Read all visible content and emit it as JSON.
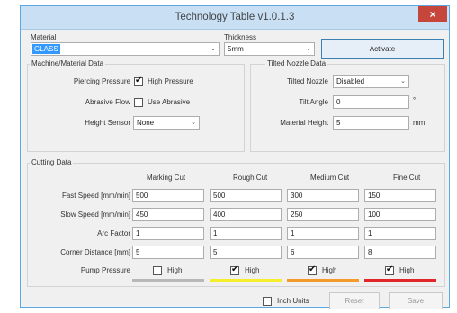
{
  "window": {
    "title": "Technology Table v1.0.1.3",
    "close_glyph": "×"
  },
  "material": {
    "label": "Material",
    "value": "GLASS"
  },
  "thickness": {
    "label": "Thickness",
    "value": "5mm"
  },
  "activate_label": "Activate",
  "machine": {
    "caption": "Machine/Material Data",
    "piercing_label": "Piercing Pressure",
    "high_pressure_label": "High Pressure",
    "high_pressure_checked": true,
    "abrasive_label": "Abrasive Flow",
    "use_abrasive_label": "Use Abrasive",
    "use_abrasive_checked": false,
    "height_label": "Height Sensor",
    "height_value": "None"
  },
  "tilted": {
    "caption": "Tilted Nozzle Data",
    "nozzle_label": "Tilted Nozzle",
    "nozzle_value": "Disabled",
    "angle_label": "Tilt Angle",
    "angle_value": "0",
    "angle_unit": "°",
    "height_label": "Material Height",
    "height_value": "5",
    "height_unit": "mm"
  },
  "cutting": {
    "caption": "Cutting Data",
    "columns": [
      "Marking Cut",
      "Rough Cut",
      "Medium Cut",
      "Fine Cut"
    ],
    "rows": [
      {
        "label": "Fast Speed  [mm/min]",
        "values": [
          "500",
          "500",
          "300",
          "150"
        ]
      },
      {
        "label": "Slow Speed  [mm/min]",
        "values": [
          "450",
          "400",
          "250",
          "100"
        ]
      },
      {
        "label": "Arc Factor",
        "values": [
          "1",
          "1",
          "1",
          "1"
        ]
      },
      {
        "label": "Corner Distance  [mm]",
        "values": [
          "5",
          "5",
          "6",
          "8"
        ]
      }
    ],
    "pump_label": "Pump Pressure",
    "pump": [
      {
        "label": "High",
        "checked": false,
        "color": "#b8b8b8"
      },
      {
        "label": "High",
        "checked": true,
        "color": "#f5ee2a"
      },
      {
        "label": "High",
        "checked": true,
        "color": "#f39a2c"
      },
      {
        "label": "High",
        "checked": true,
        "color": "#e1262b"
      }
    ]
  },
  "footer": {
    "inch_units_label": "Inch Units",
    "inch_units_checked": false,
    "reset_label": "Reset",
    "save_label": "Save"
  },
  "glyphs": {
    "check": "✔",
    "dropdown": "⌄"
  }
}
